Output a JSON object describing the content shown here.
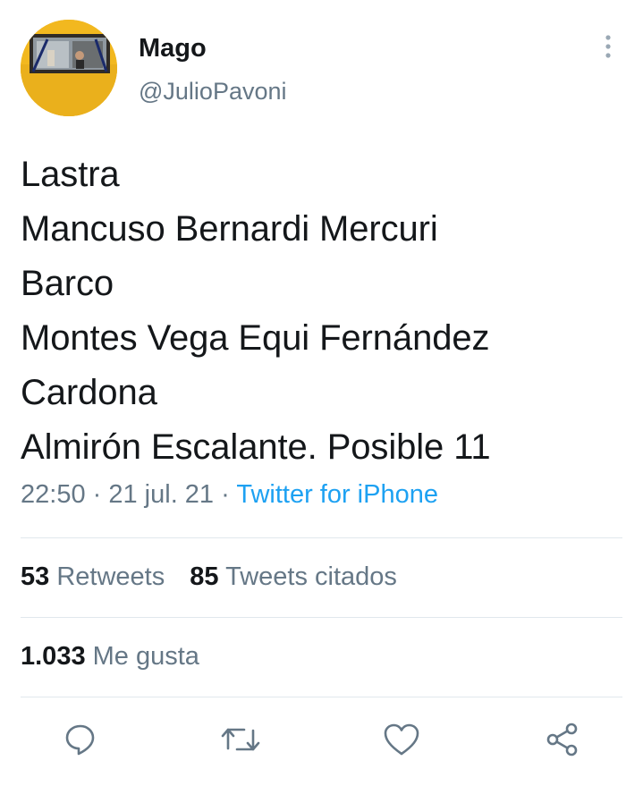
{
  "user": {
    "display_name": "Mago",
    "handle": "@JulioPavoni"
  },
  "tweet": {
    "lines": [
      "Lastra",
      "Mancuso Bernardi Mercuri",
      "Barco",
      "Montes Vega Equi Fernández",
      "Cardona",
      "Almirón Escalante. Posible 11"
    ],
    "time": "22:50",
    "date": "21 jul. 21",
    "source": "Twitter for iPhone"
  },
  "stats": {
    "retweets_count": "53",
    "retweets_label": "Retweets",
    "quotes_count": "85",
    "quotes_label": "Tweets citados",
    "likes_count": "1.033",
    "likes_label": "Me gusta"
  },
  "icons": {
    "more": "more-vertical-icon",
    "reply": "reply-icon",
    "retweet": "retweet-icon",
    "like": "heart-icon",
    "share": "share-icon"
  },
  "colors": {
    "text": "#14171a",
    "secondary": "#657786",
    "link": "#1da1f2",
    "divider": "#e1e8ed",
    "avatar_bg": "#f2b81f"
  }
}
